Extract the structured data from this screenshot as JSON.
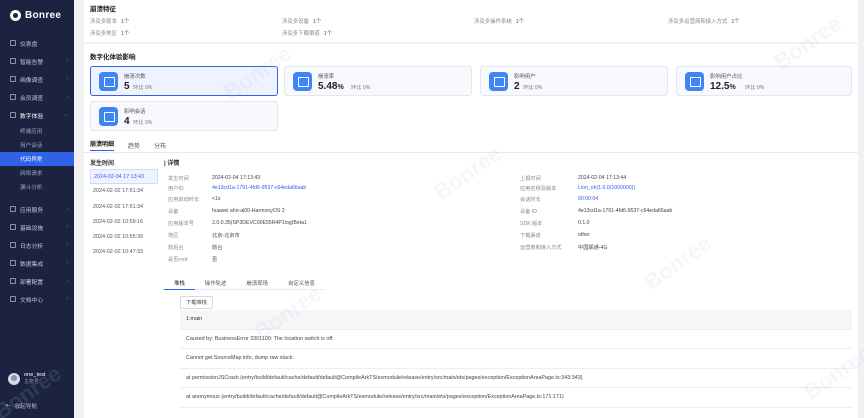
{
  "sidebar": {
    "logo": "Bonree",
    "items": [
      {
        "label": "仪表盘",
        "icon": "dashboard-icon"
      },
      {
        "label": "智能告警",
        "icon": "alarm-icon",
        "chev": "›"
      },
      {
        "label": "画像调查",
        "icon": "profile-icon",
        "chev": "›"
      },
      {
        "label": "会员调查",
        "icon": "member-icon",
        "chev": "›"
      },
      {
        "label": "数字体验",
        "icon": "experience-icon",
        "chev": "⌄"
      }
    ],
    "sub_items": [
      {
        "label": "终端应用",
        "active": false
      },
      {
        "label": "用户会话",
        "active": false
      },
      {
        "label": "代码异常",
        "active": true
      },
      {
        "label": "网络请求",
        "active": false
      },
      {
        "label": "漏斗分析",
        "active": false
      }
    ],
    "items2": [
      {
        "label": "应用服务",
        "icon": "app-service-icon",
        "chev": "›"
      },
      {
        "label": "基础设施",
        "icon": "infra-icon",
        "chev": "›"
      },
      {
        "label": "日志分析",
        "icon": "log-icon",
        "chev": "›"
      },
      {
        "label": "数据集成",
        "icon": "data-icon",
        "chev": "›"
      },
      {
        "label": "部署配置",
        "icon": "deploy-icon",
        "chev": "›"
      },
      {
        "label": "文档中心",
        "icon": "doc-icon",
        "chev": "›"
      }
    ],
    "user": {
      "name": "one_test",
      "role": "主账号"
    },
    "collapse_label": "收起导航"
  },
  "features": {
    "title": "崩溃特征",
    "rows": [
      [
        {
          "k": "涉及多版本",
          "v": "1个"
        },
        {
          "k": "涉及多设备",
          "v": "1个"
        },
        {
          "k": "涉及多操作系统",
          "v": "1个"
        },
        {
          "k": "涉及多运营商和接入方式",
          "v": "1个"
        }
      ],
      [
        {
          "k": "涉及多地区",
          "v": "1个"
        },
        {
          "k": "涉及多下载渠道",
          "v": "1个"
        }
      ]
    ]
  },
  "impact": {
    "title": "数字化体验影响",
    "cards": [
      {
        "title": "崩溃次数",
        "value": "5",
        "ring_label": "环比",
        "ring": "0%",
        "active": true
      },
      {
        "title": "崩溃率",
        "value": "5.48",
        "unit": "%",
        "ring_label": "环比",
        "ring": "0%",
        "active": false
      },
      {
        "title": "影响用户",
        "value": "2",
        "ring_label": "环比",
        "ring": "0%",
        "active": false
      },
      {
        "title": "影响用户占比",
        "value": "12.5",
        "unit": "%",
        "ring_label": "环比",
        "ring": "0%",
        "active": false
      },
      {
        "title": "影响会话",
        "value": "4",
        "ring_label": "环比",
        "ring": "0%",
        "active": false
      }
    ]
  },
  "tabs": [
    "崩溃明细",
    "趋势",
    "分布"
  ],
  "times": {
    "head": "发生时间",
    "rows": [
      "2024-02-04 17:13:43",
      "2024-02-02 17:51:34",
      "2024-02-02 17:51:34",
      "2024-02-02 10:59:16",
      "2024-02-02 10:55:39",
      "2024-02-02 10:47:33"
    ]
  },
  "detail": {
    "head": "详情",
    "left": [
      {
        "k": "发生时间",
        "v": "2024-02-04 17:13:43"
      },
      {
        "k": "用户ID",
        "v": "4e13cd1a-1791-4fd6-9537-c64eda66aab",
        "link": true
      },
      {
        "k": "应用启动时长",
        "v": "<1s"
      },
      {
        "k": "设备",
        "v": "huawei ahn-al00-HarmonyOS 2"
      },
      {
        "k": "应用版本号",
        "v": "2.0.0.35(SP3DEVC00E55R4P1log)Beta1"
      },
      {
        "k": "地区",
        "v": "北京-北京市"
      },
      {
        "k": "前后台",
        "v": "前台"
      },
      {
        "k": "是否root",
        "v": "否"
      }
    ],
    "right": [
      {
        "k": "上报时间",
        "v": "2024-02-04 17:13:44"
      },
      {
        "k": "应用名称及版本",
        "v": "Lion_oh(1.0.0(1000000))",
        "link": true
      },
      {
        "k": "会话时长",
        "v": "00:00:04",
        "link": true
      },
      {
        "k": "设备 ID",
        "v": "4e13cd1a-1791-4fd6-9537-c64eda66aab"
      },
      {
        "k": "SDK 版本",
        "v": "0.1.0"
      },
      {
        "k": "下载渠道",
        "v": "other"
      },
      {
        "k": "运营商和接入方式",
        "v": "中国联通-4G"
      }
    ]
  },
  "sub_tabs": [
    "堆栈",
    "操作轨迹",
    "崩溃现场",
    "自定义信息"
  ],
  "download_label": "下载堆栈",
  "stack": [
    "1:main",
    "Caused by: BusinessError 3301100: The location switch is off.",
    "Cannot get SourceMap info, dump raw stack:",
    "at permissionJSCrash (entry/build/default/cache/default/default@CompileArkTS/esmodule/release/entry/src/main/ets/pages/exception/ExceptionAreaPage.ts:343:343)",
    "at anonymous (entry/build/default/cache/default/default@CompileArkTS/esmodule/release/entry/src/main/ets/pages/exception/ExceptionAreaPage.ts:171:171)"
  ],
  "watermark": "Bonree"
}
